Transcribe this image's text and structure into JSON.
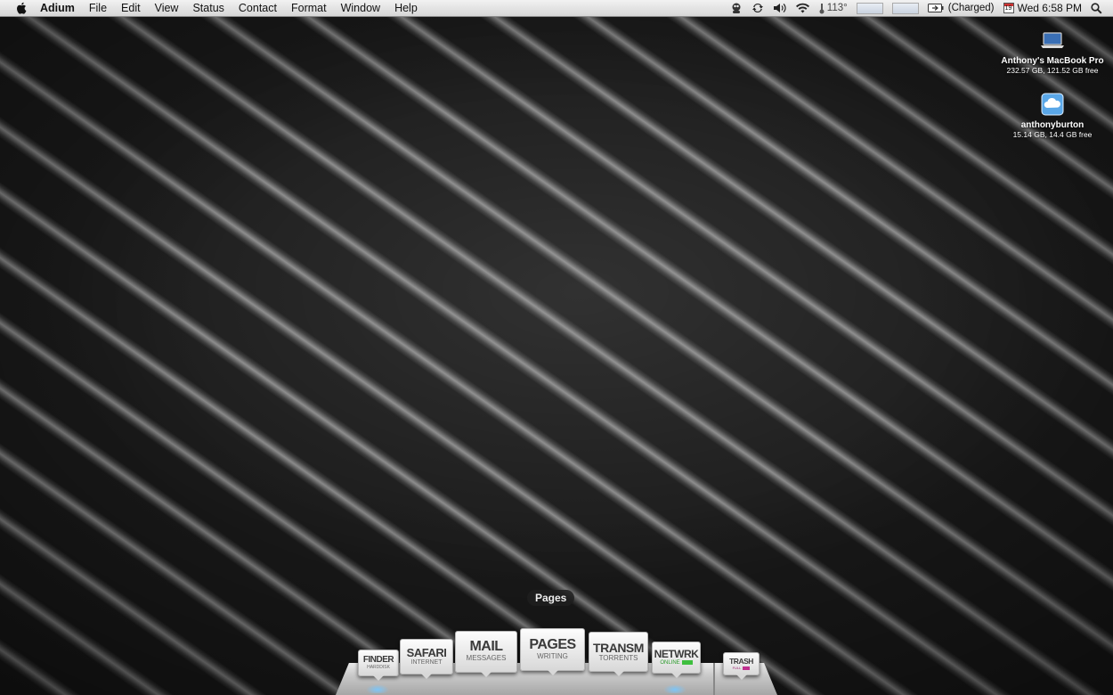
{
  "menubar": {
    "app_name": "Adium",
    "items": [
      "File",
      "Edit",
      "View",
      "Status",
      "Contact",
      "Format",
      "Window",
      "Help"
    ],
    "status": {
      "temperature": "113°",
      "battery_status": "(Charged)",
      "calendar_day": "19",
      "clock": "Wed 6:58 PM"
    }
  },
  "desktop_icons": [
    {
      "name": "Anthony's MacBook Pro",
      "info": "232.57 GB, 121.52 GB free",
      "icon": "laptop-icon"
    },
    {
      "name": "anthonyburton",
      "info": "15.14 GB, 14.4 GB free",
      "icon": "cloud-drive-icon"
    }
  ],
  "dock": {
    "hover_label": "Pages",
    "items": [
      {
        "title": "FINDER",
        "subtitle": "HARDDISK"
      },
      {
        "title": "SAFARI",
        "subtitle": "INTERNET"
      },
      {
        "title": "MAIL",
        "subtitle": "MESSAGES"
      },
      {
        "title": "PAGES",
        "subtitle": "WRITING"
      },
      {
        "title": "TRANSM",
        "subtitle": "TORRENTS"
      },
      {
        "title": "NETWRK",
        "subtitle": "ONLINE"
      },
      {
        "title": "TRASH",
        "subtitle": "FULL"
      }
    ]
  },
  "colors": {
    "network_online": "#3fbf3f",
    "network_online_text": "#2a9a2a",
    "trash_full": "#c0308f",
    "trash_full_text": "#a02070"
  }
}
